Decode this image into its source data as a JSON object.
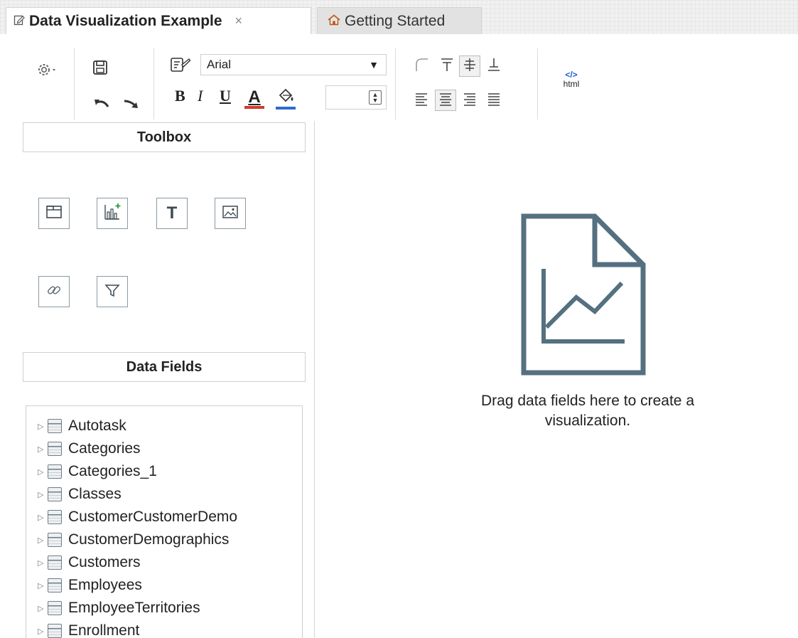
{
  "tabs": [
    {
      "label": "Data Visualization Example",
      "icon": "edit-document-icon",
      "close": "×",
      "active": true
    },
    {
      "label": "Getting Started",
      "icon": "home-icon",
      "active": false
    }
  ],
  "toolbar": {
    "font_family": "Arial",
    "font_size": "",
    "html_label": "html",
    "format": {
      "bold": "B",
      "italic": "I",
      "underline": "U",
      "font_color": "A"
    },
    "colors": {
      "font_color_bar": "#d23a2a",
      "fill_color_bar": "#2f6bd1",
      "html_icon": "#1a5fd6"
    }
  },
  "toolbox": {
    "title": "Toolbox",
    "tools": [
      {
        "name": "container-tool",
        "icon": "container-icon"
      },
      {
        "name": "chart-tool",
        "icon": "add-chart-icon"
      },
      {
        "name": "text-tool",
        "icon": "text-icon",
        "glyph": "T"
      },
      {
        "name": "image-tool",
        "icon": "image-icon"
      },
      {
        "name": "link-tool",
        "icon": "link-icon"
      },
      {
        "name": "filter-tool",
        "icon": "filter-icon"
      }
    ]
  },
  "data_fields": {
    "title": "Data Fields",
    "items": [
      "Autotask",
      "Categories",
      "Categories_1",
      "Classes",
      "CustomerCustomerDemo",
      "CustomerDemographics",
      "Customers",
      "Employees",
      "EmployeeTerritories",
      "Enrollment"
    ]
  },
  "canvas": {
    "placeholder_line1": "Drag data fields here to create a",
    "placeholder_line2": "visualization.",
    "icon_color": "#557080"
  }
}
